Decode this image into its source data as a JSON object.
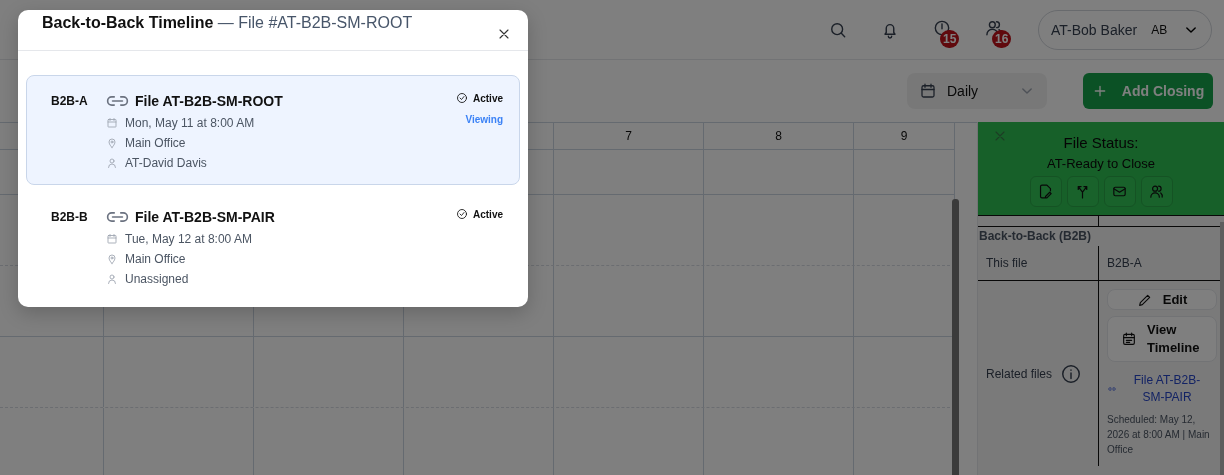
{
  "top_bar": {
    "notifications": [
      {
        "kind": "clock",
        "count": "15"
      },
      {
        "kind": "people",
        "count": "16"
      }
    ],
    "user": {
      "name": "AT-Bob Baker",
      "initials": "AB"
    }
  },
  "toolbar": {
    "view": "Daily",
    "add_button": "Add Closing"
  },
  "calendar": {
    "column_labels": [
      "7",
      "8",
      "9"
    ]
  },
  "file_panel": {
    "title": "File Status:",
    "status": "AT-Ready to Close",
    "section": "Back-to-Back (B2B)",
    "this_file": {
      "label": "This file",
      "value": "B2B-A"
    },
    "related": {
      "label": "Related files",
      "edit_button": "Edit",
      "timeline_button": "View Timeline",
      "link": "File AT-B2B-SM-PAIR",
      "scheduled": "Scheduled: May 12, 2026 at 8:00 AM | Main Office"
    }
  },
  "modal": {
    "title": "Back-to-Back Timeline",
    "subtitle": "— File #AT-B2B-SM-ROOT",
    "items": [
      {
        "code": "B2B-A",
        "file": "File AT-B2B-SM-ROOT",
        "date": "Mon, May 11 at 8:00 AM",
        "location": "Main Office",
        "assignee": "AT-David Davis",
        "status": "Active",
        "selected": true,
        "viewing_label": "Viewing"
      },
      {
        "code": "B2B-B",
        "file": "File AT-B2B-SM-PAIR",
        "date": "Tue, May 12 at 8:00 AM",
        "location": "Main Office",
        "assignee": "Unassigned",
        "status": "Active",
        "selected": false
      }
    ]
  }
}
